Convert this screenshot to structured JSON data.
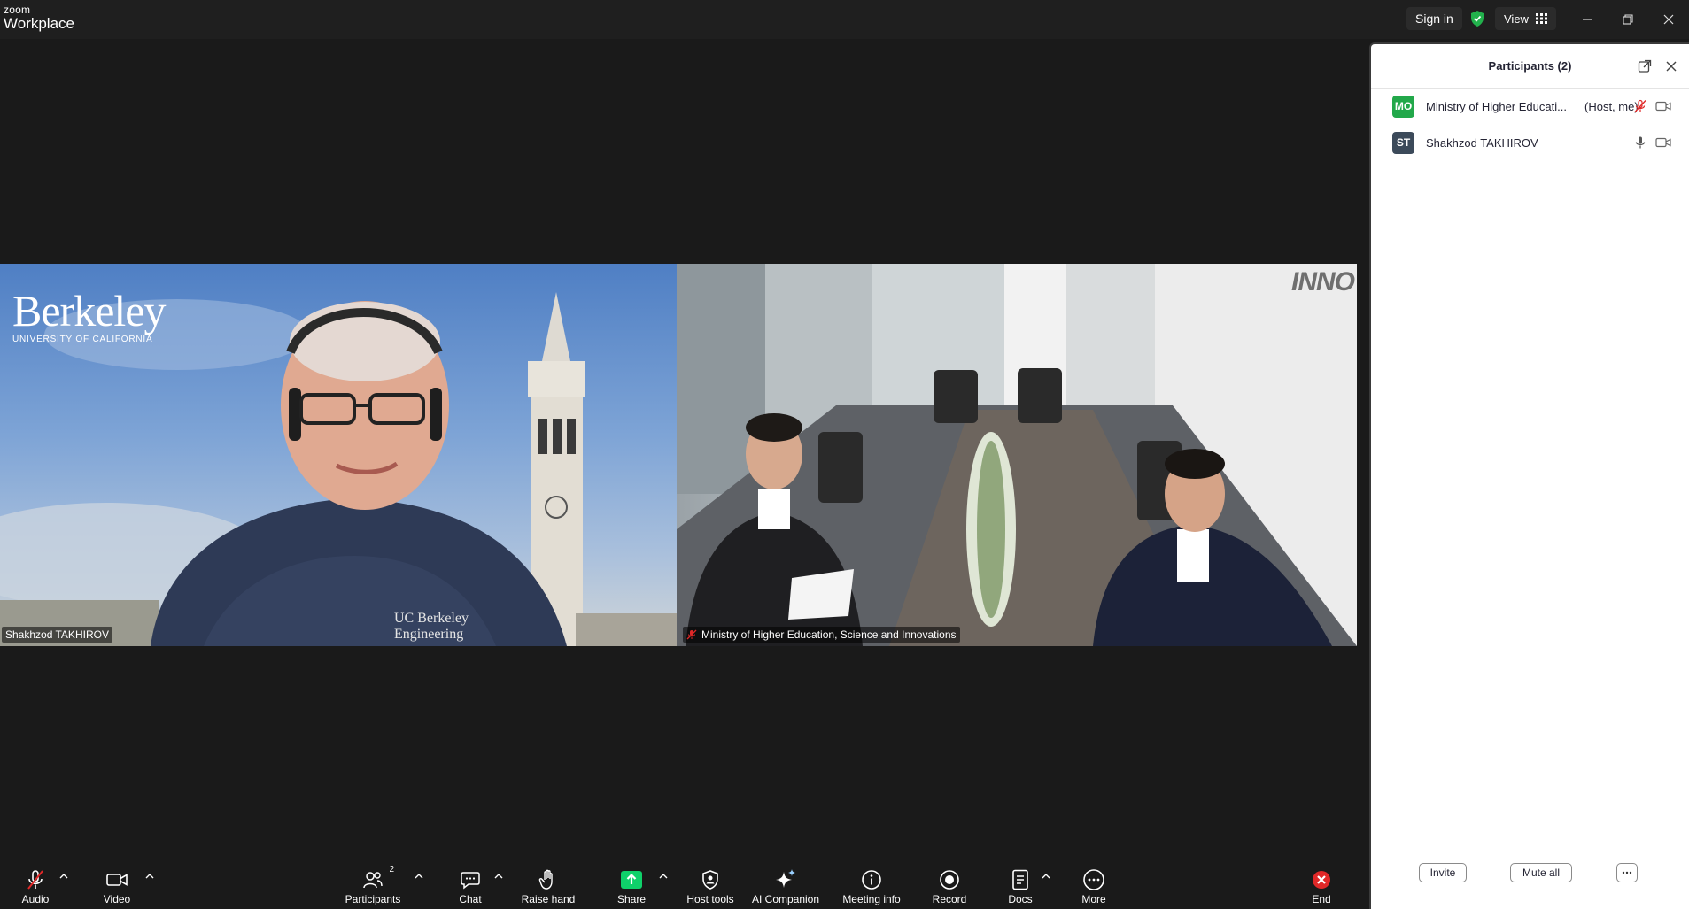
{
  "app": {
    "logo_line1": "zoom",
    "logo_line2": "Workplace",
    "sign_in": "Sign in",
    "view": "View"
  },
  "videos": {
    "left": {
      "name": "Shakhzod TAKHIROV",
      "bg_logo": "Berkeley",
      "bg_logo_sub": "UNIVERSITY OF CALIFORNIA",
      "shirt_line1": "UC Berkeley",
      "shirt_line2": "Engineering"
    },
    "right": {
      "name": "Ministry of Higher Education, Science and Innovations",
      "watermark": "INNO",
      "muted": true
    }
  },
  "participants_panel": {
    "title": "Participants (2)",
    "participants": [
      {
        "initials": "MO",
        "avatar_color": "#22a84a",
        "name": "Ministry of Higher Educati...",
        "role": "(Host, me)",
        "mic": "muted",
        "video": "on"
      },
      {
        "initials": "ST",
        "avatar_color": "#3c4a5a",
        "name": "Shakhzod TAKHIROV",
        "role": "",
        "mic": "on",
        "video": "on"
      }
    ],
    "invite": "Invite",
    "mute_all": "Mute all",
    "more": "..."
  },
  "toolbar": {
    "audio": "Audio",
    "video": "Video",
    "participants": "Participants",
    "participants_count": "2",
    "chat": "Chat",
    "raise_hand": "Raise hand",
    "share": "Share",
    "host_tools": "Host tools",
    "ai_companion": "AI Companion",
    "meeting_info": "Meeting info",
    "record": "Record",
    "docs": "Docs",
    "more": "More",
    "end": "End"
  },
  "colors": {
    "share_green": "#0fd16a",
    "end_red": "#e02828",
    "muted_red": "#e02828",
    "shield_green": "#22b14c"
  }
}
